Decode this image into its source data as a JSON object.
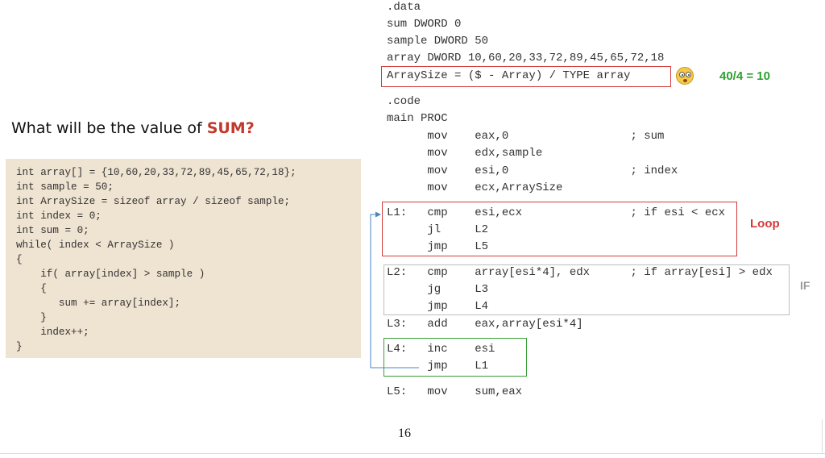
{
  "question": {
    "prefix": "What will be the value of ",
    "emphasis": "SUM?"
  },
  "c_code": [
    "int array[] = {10,60,20,33,72,89,45,65,72,18};",
    "int sample = 50;",
    "int ArraySize = sizeof array / sizeof sample;",
    "int index = 0;",
    "int sum = 0;",
    "while( index < ArraySize )",
    "{",
    "    if( array[index] > sample )",
    "    {",
    "       sum += array[index];",
    "    }",
    "    index++;",
    "}"
  ],
  "asm_code": [
    ".data",
    "sum DWORD 0",
    "sample DWORD 50",
    "array DWORD 10,60,20,33,72,89,45,65,72,18",
    "ArraySize = ($ - Array) / TYPE array",
    "",
    ".code",
    "main PROC",
    "      mov    eax,0                  ; sum",
    "      mov    edx,sample",
    "      mov    esi,0                  ; index",
    "      mov    ecx,ArraySize",
    "L1:   cmp    esi,ecx                ; if esi < ecx",
    "      jl     L2",
    "      jmp    L5",
    "L2:   cmp    array[esi*4], edx      ; if array[esi] > edx",
    "      jg     L3",
    "      jmp    L4",
    "L3:   add    eax,array[esi*4]",
    "L4:   inc    esi",
    "      jmp    L1",
    "",
    "L5:   mov    sum,eax"
  ],
  "annotations": {
    "arraysize_calc": "40/4 = 10",
    "loop_label": "Loop",
    "if_label": "IF"
  },
  "emoji_icon": "flushed-face-icon",
  "page_number": "16",
  "colors": {
    "accent_red": "#c0392b",
    "box_red": "#d23b3b",
    "box_green": "#3a9e3a",
    "box_gray": "#bdbdbd",
    "panel_bg": "#efe3d1",
    "arrow_blue": "#4a86c8"
  }
}
